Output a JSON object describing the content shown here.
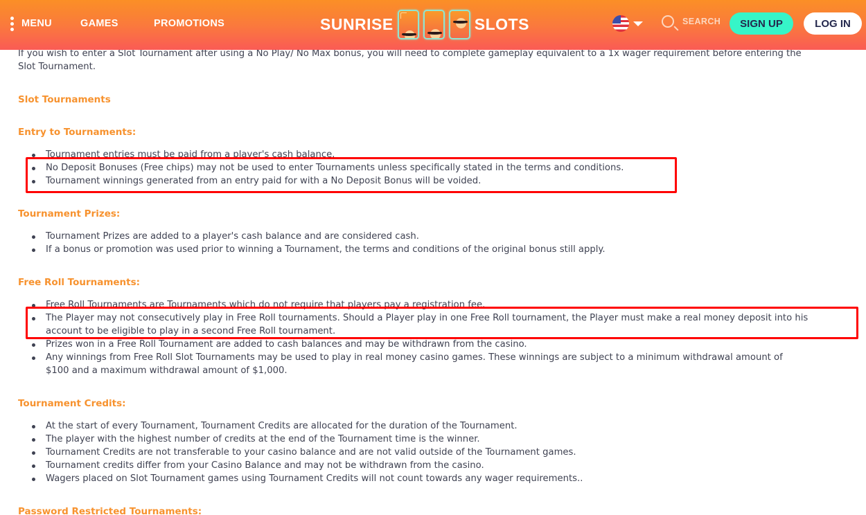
{
  "header": {
    "menu_label": "MENU",
    "nav": [
      "GAMES",
      "PROMOTIONS"
    ],
    "logo_left": "SUNRISE",
    "logo_right": "SLOTS",
    "language_flag": "us-flag-icon",
    "search_label": "SEARCH",
    "signup_label": "SIGN UP",
    "login_label": "LOG IN",
    "colors": {
      "gradient_top": "#fb8f26",
      "gradient_bottom": "#fa5b55",
      "signup_bg": "#36f5c8",
      "button_text": "#24284d"
    }
  },
  "content": {
    "intro_lines": [
      "If you wish to enter a Slot Tournament after using a No Play/ No Max bonus, you will need to complete gameplay equivalent to a 1x wager requirement before entering the",
      "Slot Tournament."
    ],
    "title": "Slot Tournaments",
    "sections": [
      {
        "heading": "Entry to Tournaments:",
        "items": [
          [
            "Tournament entries must be paid from a player's cash balance."
          ],
          [
            "No Deposit Bonuses (Free chips) may not be used to enter Tournaments unless specifically stated in the terms and conditions."
          ],
          [
            "Tournament winnings generated from an entry paid for with a No Deposit Bonus will be voided."
          ]
        ]
      },
      {
        "heading": "Tournament Prizes:",
        "items": [
          [
            "Tournament Prizes are added to a player's cash balance and are considered cash."
          ],
          [
            "If a bonus or promotion was used prior to winning a Tournament, the terms and conditions of the original bonus still apply."
          ]
        ]
      },
      {
        "heading": "Free Roll Tournaments:",
        "items": [
          [
            "Free Roll Tournaments are Tournaments which do not require that players pay a registration fee."
          ],
          [
            "The Player may not consecutively play in Free Roll tournaments. Should a Player play in one Free Roll tournament, the Player must make a real money deposit into his",
            "account to be eligible to play in a second Free Roll tournament."
          ],
          [
            "Prizes won in a Free Roll Tournament are added to cash balances and may be withdrawn from the casino."
          ],
          [
            "Any winnings from Free Roll Slot Tournaments may be used to play in real money casino games. These winnings are subject to a minimum withdrawal amount of",
            "$100 and a maximum withdrawal amount of $1,000."
          ]
        ]
      },
      {
        "heading": "Tournament Credits:",
        "items": [
          [
            "At the start of every Tournament, Tournament Credits are allocated for the duration of the Tournament."
          ],
          [
            "The player with the highest number of credits at the end of the Tournament time is the winner."
          ],
          [
            "Tournament Credits are not transferable to your casino balance and are not valid outside of the Tournament games."
          ],
          [
            "Tournament credits differ from your Casino Balance and may not be withdrawn from the casino."
          ],
          [
            "Wagers placed on Slot Tournament games using Tournament Credits will not count towards any wager requirements.."
          ]
        ]
      },
      {
        "heading": "Password Restricted Tournaments:",
        "items": []
      }
    ],
    "highlight_color": "#ff0000",
    "heading_color": "#f7922e"
  }
}
